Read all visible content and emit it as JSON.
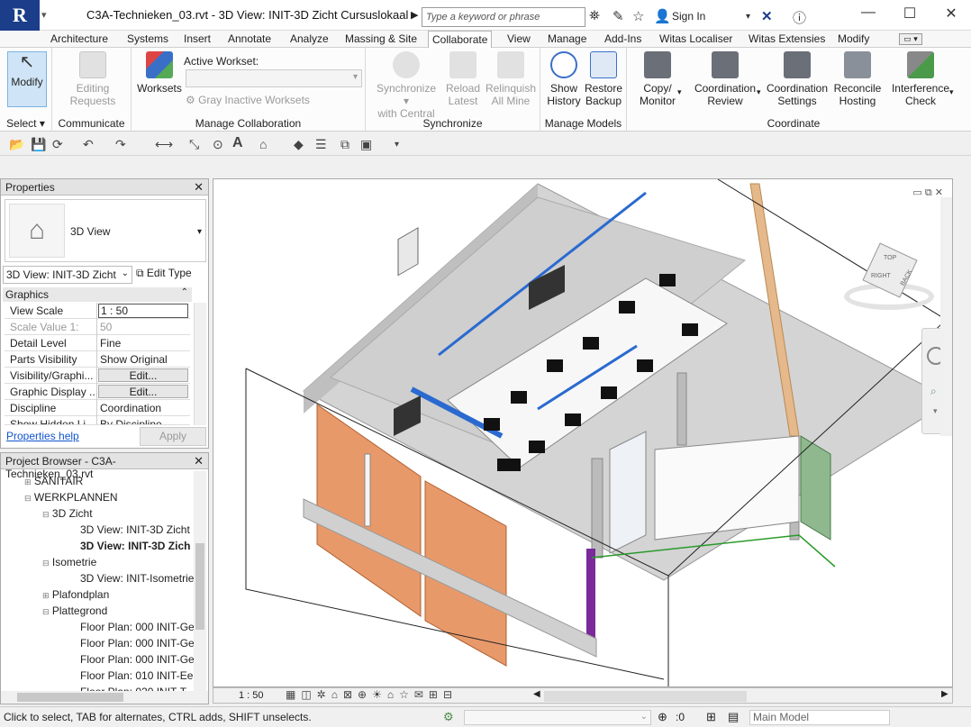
{
  "window": {
    "title": "C3A-Technieken_03.rvt - 3D View: INIT-3D Zicht Cursuslokaal",
    "search_placeholder": "Type a keyword or phrase",
    "sign_in": "Sign In"
  },
  "tabs": [
    "Architecture",
    "Systems",
    "Insert",
    "Annotate",
    "Analyze",
    "Massing & Site",
    "Collaborate",
    "View",
    "Manage",
    "Add-Ins",
    "Witas Localiser",
    "Witas Extensies",
    "Modify"
  ],
  "active_tab": "Collaborate",
  "ribbon": {
    "select": {
      "modify": "Modify",
      "label": "Select"
    },
    "communicate": {
      "editing": "Editing",
      "requests": "Requests",
      "label": "Communicate"
    },
    "collab": {
      "worksets": "Worksets",
      "active_workset": "Active Workset:",
      "gray": "Gray Inactive Worksets",
      "label": "Manage Collaboration"
    },
    "sync": {
      "sync1": "Synchronize",
      "sync2": "with Central",
      "reload1": "Reload",
      "reload2": "Latest",
      "relinq1": "Relinquish",
      "relinq2": "All Mine",
      "label": "Synchronize"
    },
    "models": {
      "show1": "Show",
      "show2": "History",
      "restore1": "Restore",
      "restore2": "Backup",
      "label": "Manage Models"
    },
    "coord": {
      "copy1": "Copy/",
      "copy2": "Monitor",
      "rev1": "Coordination",
      "rev2": "Review",
      "set1": "Coordination",
      "set2": "Settings",
      "rec1": "Reconcile",
      "rec2": "Hosting",
      "int1": "Interference",
      "int2": "Check",
      "label": "Coordinate"
    }
  },
  "properties": {
    "title": "Properties",
    "type_name": "3D View",
    "selector": "3D View: INIT-3D Zicht",
    "edit_type": "Edit Type",
    "group": "Graphics",
    "rows": [
      {
        "k": "View Scale",
        "v": "1 : 50"
      },
      {
        "k": "Scale Value    1:",
        "v": "50"
      },
      {
        "k": "Detail Level",
        "v": "Fine"
      },
      {
        "k": "Parts Visibility",
        "v": "Show Original"
      },
      {
        "k": "Visibility/Graphi...",
        "v": "Edit..."
      },
      {
        "k": "Graphic Display ...",
        "v": "Edit..."
      },
      {
        "k": "Discipline",
        "v": "Coordination"
      },
      {
        "k": "Show Hidden Li...",
        "v": "By Discipline"
      }
    ],
    "help": "Properties help",
    "apply": "Apply"
  },
  "browser": {
    "title": "Project Browser - C3A-Technieken_03.rvt",
    "nodes": [
      {
        "t": "SANITAIR"
      },
      {
        "t": "WERKPLANNEN"
      },
      {
        "t": "3D Zicht"
      },
      {
        "t": "3D View: INIT-3D Zicht"
      },
      {
        "t": "3D View: INIT-3D Zich"
      },
      {
        "t": "Isometrie"
      },
      {
        "t": "3D View: INIT-Isometrie"
      },
      {
        "t": "Plafondplan"
      },
      {
        "t": "Plattegrond"
      },
      {
        "t": "Floor Plan: 000 INIT-Ge"
      },
      {
        "t": "Floor Plan: 000 INIT-Ge"
      },
      {
        "t": "Floor Plan: 000 INIT-Ge"
      },
      {
        "t": "Floor Plan: 010 INIT-Eer"
      },
      {
        "t": "Floor Plan: 020 INIT-T"
      }
    ]
  },
  "viewcube": {
    "face_front": "RIGHT",
    "face_top": "TOP",
    "face_right": "BACK"
  },
  "viewbar": {
    "scale": "1 : 50"
  },
  "status": {
    "hint": "Click to select, TAB for alternates, CTRL adds, SHIFT unselects.",
    "count": ":0",
    "model": "Main Model"
  },
  "colors": {
    "accent": "#1b3d8a",
    "orange_wall": "#e8996a",
    "green_panel": "#8fb88f",
    "wood": "#e5b98b"
  }
}
